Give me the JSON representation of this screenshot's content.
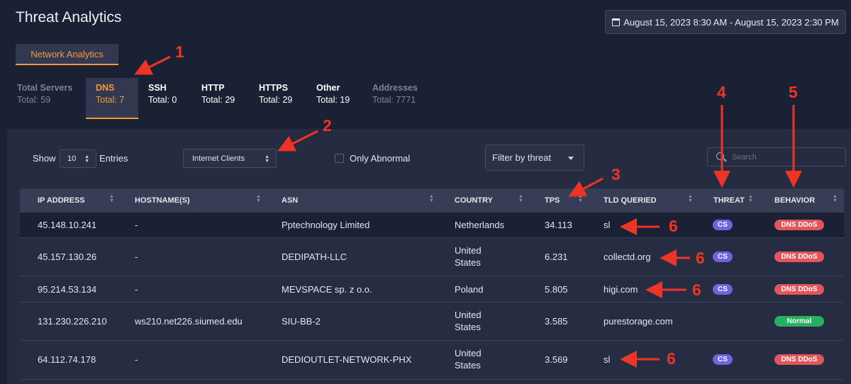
{
  "header": {
    "title": "Threat Analytics",
    "date_range": "August 15, 2023 8:30 AM - August 15, 2023 2:30 PM"
  },
  "nav": {
    "network_tab": "Network Analytics"
  },
  "stats": [
    {
      "name": "Total Servers",
      "value": "Total: 59"
    },
    {
      "name": "DNS",
      "value": "Total: 7"
    },
    {
      "name": "SSH",
      "value": "Total: 0"
    },
    {
      "name": "HTTP",
      "value": "Total: 29"
    },
    {
      "name": "HTTPS",
      "value": "Total: 29"
    },
    {
      "name": "Other",
      "value": "Total: 19"
    },
    {
      "name": "Addresses",
      "value": "Total: 7771"
    }
  ],
  "controls": {
    "show_label": "Show",
    "entries_value": "10",
    "entries_label": "Entries",
    "clients_value": "Internet Clients",
    "only_abnormal": "Only Abnormal",
    "threat_filter": "Filter by threat",
    "search_placeholder": "Search"
  },
  "table": {
    "headers": [
      "IP ADDRESS",
      "HOSTNAME(S)",
      "ASN",
      "COUNTRY",
      "TPS",
      "TLD QUERIED",
      "THREAT",
      "BEHAVIOR"
    ],
    "rows": [
      {
        "ip": "45.148.10.241",
        "host": "-",
        "asn": "Pptechnology Limited",
        "country1": "Netherlands",
        "country2": "",
        "tps": "34.113",
        "tld": "sl",
        "threat": "CS",
        "behavior": "DNS DDoS"
      },
      {
        "ip": "45.157.130.26",
        "host": "-",
        "asn": "DEDIPATH-LLC",
        "country1": "United",
        "country2": "States",
        "tps": "6.231",
        "tld": "collectd.org",
        "threat": "CS",
        "behavior": "DNS DDoS"
      },
      {
        "ip": "95.214.53.134",
        "host": "-",
        "asn": "MEVSPACE sp. z o.o.",
        "country1": "Poland",
        "country2": "",
        "tps": "5.805",
        "tld": "higi.com",
        "threat": "CS",
        "behavior": "DNS DDoS"
      },
      {
        "ip": "131.230.226.210",
        "host": "ws210.net226.siumed.edu",
        "asn": "SIU-BB-2",
        "country1": "United",
        "country2": "States",
        "tps": "3.585",
        "tld": "purestorage.com",
        "threat": "",
        "behavior": "Normal"
      },
      {
        "ip": "64.112.74.178",
        "host": "-",
        "asn": "DEDIOUTLET-NETWORK-PHX",
        "country1": "United",
        "country2": "States",
        "tps": "3.569",
        "tld": "sl",
        "threat": "CS",
        "behavior": "DNS DDoS"
      }
    ]
  },
  "annotations": [
    "1",
    "2",
    "3",
    "4",
    "5",
    "6",
    "6",
    "6",
    "6"
  ],
  "colors": {
    "accent": "#f29a3a",
    "annotation": "#ee3424",
    "threat_pill": "#6f63e0",
    "ddos_pill": "#e2555d",
    "normal_pill": "#27b060"
  }
}
